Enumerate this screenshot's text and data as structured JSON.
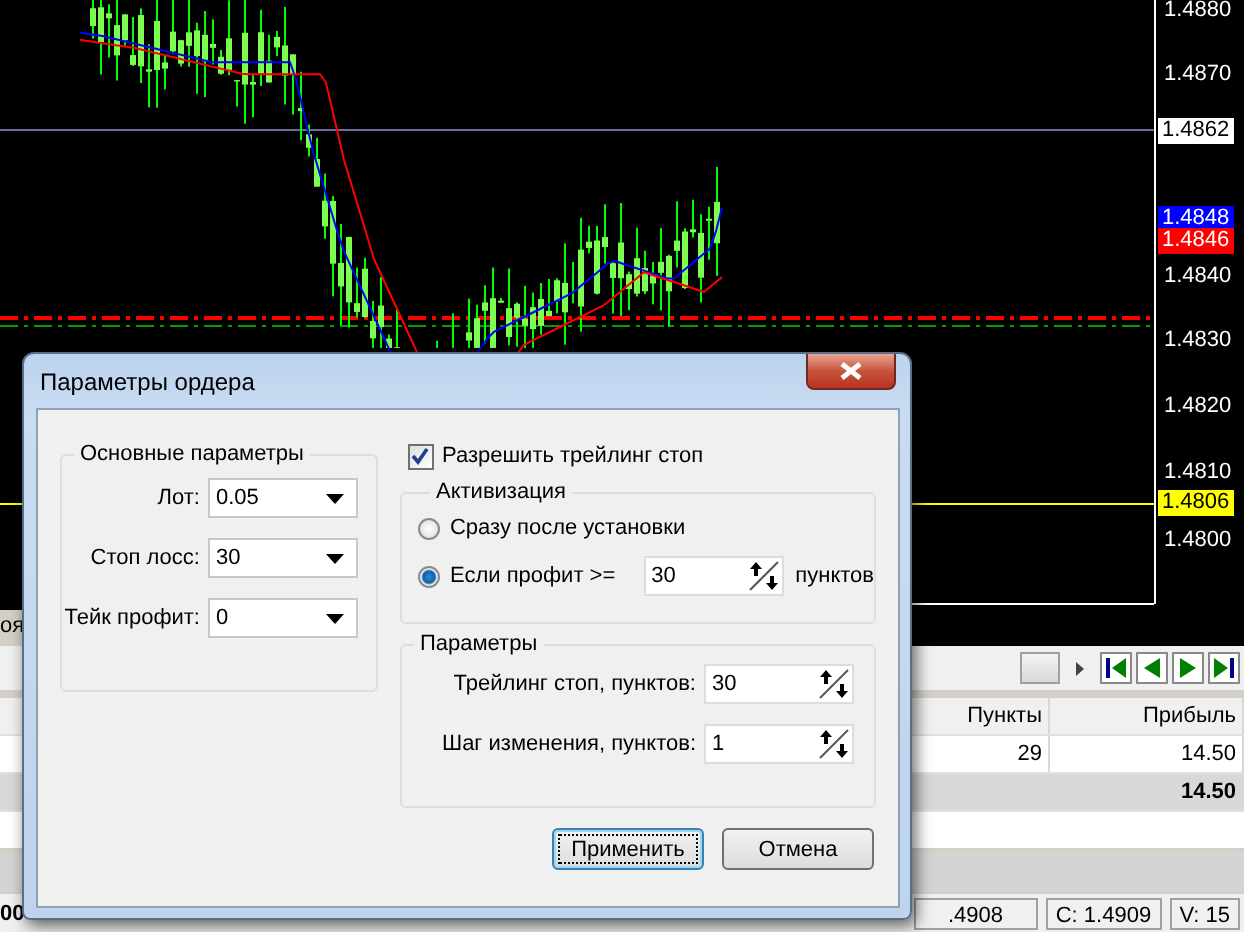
{
  "price_axis": [
    {
      "label": "1.4880"
    },
    {
      "label": "1.4870"
    },
    {
      "label": "1.4862",
      "kind": "marker",
      "color": "#ffffff"
    },
    {
      "label": "1.4848",
      "kind": "marker",
      "color": "#0000ff"
    },
    {
      "label": "1.4846",
      "kind": "marker",
      "color": "#ff0000"
    },
    {
      "label": "1.4840"
    },
    {
      "label": "1.4830"
    },
    {
      "label": "1.4820"
    },
    {
      "label": "1.4810"
    },
    {
      "label": "1.4806",
      "kind": "marker",
      "color": "#ffff00"
    },
    {
      "label": "1.4800"
    }
  ],
  "terminal": {
    "tab_fragment": "оя",
    "columns": [
      "Пункты",
      "Прибыль"
    ],
    "rows": [
      [
        "29",
        "14.50"
      ]
    ],
    "total": "14.50"
  },
  "status_bar": {
    "fragment": "00",
    "cells": [
      ".4908",
      "C: 1.4909",
      "V: 15"
    ]
  },
  "dialog": {
    "title": "Параметры ордера",
    "main_group": {
      "title": "Основные параметры",
      "fields": [
        {
          "label": "Лот:",
          "value": "0.05"
        },
        {
          "label": "Стоп лосс:",
          "value": "30"
        },
        {
          "label": "Тейк профит:",
          "value": "0"
        }
      ]
    },
    "trailing": {
      "label": "Разрешить трейлинг стоп",
      "checked": true
    },
    "activation": {
      "title": "Активизация",
      "options": [
        {
          "label": "Сразу после установки",
          "selected": false
        },
        {
          "label": "Если профит >=",
          "selected": true,
          "value": "30",
          "unit": "пунктов"
        }
      ]
    },
    "params": {
      "title": "Параметры",
      "fields": [
        {
          "label": "Трейлинг стоп, пунктов:",
          "value": "30"
        },
        {
          "label": "Шаг изменения, пунктов:",
          "value": "1"
        }
      ]
    },
    "buttons": [
      {
        "label": "Применить",
        "focused": true
      },
      {
        "label": "Отмена",
        "focused": false
      }
    ]
  }
}
